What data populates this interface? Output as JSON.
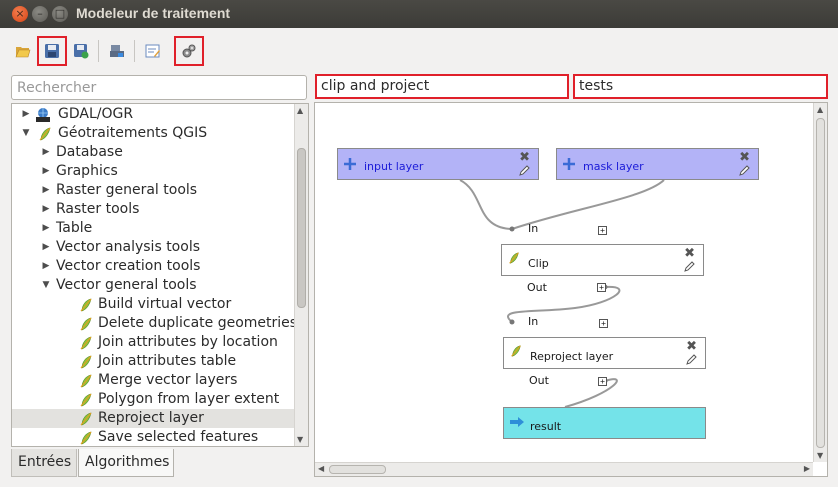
{
  "window": {
    "title": "Modeleur de traitement"
  },
  "toolbar": {
    "buttons": [
      {
        "name": "open-model",
        "icon": "folder-open-icon"
      },
      {
        "name": "save-model",
        "icon": "save-icon",
        "highlighted": true
      },
      {
        "name": "save-as-model",
        "icon": "save-as-icon"
      },
      {
        "name": "export-image",
        "icon": "export-image-icon"
      },
      {
        "name": "edit-help",
        "icon": "edit-help-icon"
      },
      {
        "name": "run-model",
        "icon": "run-gears-icon",
        "highlighted": true
      }
    ]
  },
  "search": {
    "placeholder": "Rechercher",
    "value": ""
  },
  "tree": {
    "providers": [
      {
        "label": "GDAL/OGR",
        "icon": "gdal-icon",
        "expanded": false
      },
      {
        "label": "Géotraitements QGIS",
        "icon": "qgis-icon",
        "expanded": true
      }
    ],
    "groups": [
      {
        "label": "Database",
        "expanded": false
      },
      {
        "label": "Graphics",
        "expanded": false
      },
      {
        "label": "Raster general tools",
        "expanded": false
      },
      {
        "label": "Raster tools",
        "expanded": false
      },
      {
        "label": "Table",
        "expanded": false
      },
      {
        "label": "Vector analysis tools",
        "expanded": false
      },
      {
        "label": "Vector creation tools",
        "expanded": false
      },
      {
        "label": "Vector general tools",
        "expanded": true
      }
    ],
    "algorithms": [
      {
        "label": "Build virtual vector",
        "selected": false
      },
      {
        "label": "Delete duplicate geometries",
        "selected": false
      },
      {
        "label": "Join attributes by location",
        "selected": false
      },
      {
        "label": "Join attributes table",
        "selected": false
      },
      {
        "label": "Merge vector layers",
        "selected": false
      },
      {
        "label": "Polygon from layer extent",
        "selected": false
      },
      {
        "label": "Reproject layer",
        "selected": true
      },
      {
        "label": "Save selected features",
        "selected": false
      }
    ]
  },
  "tabs": {
    "inputs": "Entrées",
    "algorithms": "Algorithmes",
    "active": "algorithms"
  },
  "model": {
    "name": "clip and project",
    "group": "tests"
  },
  "graph": {
    "inputs": [
      {
        "label": "input layer"
      },
      {
        "label": "mask layer"
      }
    ],
    "algorithms": [
      {
        "label": "Clip",
        "in_label": "In",
        "out_label": "Out"
      },
      {
        "label": "Reproject layer",
        "in_label": "In",
        "out_label": "Out"
      }
    ],
    "output": {
      "label": "result"
    },
    "colors": {
      "input_node": "#b3b3f7",
      "output_node": "#74e3e9",
      "highlight": "#e0202a"
    }
  }
}
